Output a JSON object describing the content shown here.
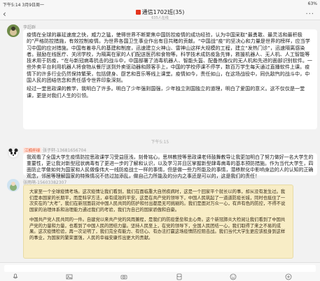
{
  "status_bar": {
    "time": "下午5:14",
    "date": "3月9日周一",
    "battery": "63%"
  },
  "header": {
    "title": "通信1702班(35)",
    "subtitle": "635人在线"
  },
  "messages": [
    {
      "sender_badge": "",
      "sender_name": "李超群",
      "paragraphs": [
        "疫情在全球的暴延速度之快，威力之猛，使得世界不断聚焦中国防控疫情的成功经验，认为中国采取“最勇敢、最灵活和最积极的”严格防控措施，有效控制疫情。为世界各国卫生事业作出有目共睹的贡献。“中国战“疫”的坚决心和力量是世界的榜样，应当学习中国的应对措施。中国有着非凡的基建和制度，迅速建立火神山、雷神山这样大规模的工程，建立“发热门诊”，迅速隔离感染者。鼓励在线医疗、关闭学校，为隔离在家的人们配送医药和食物等。科学技术成防疫急先锋，救援机器人、无人机、人工智能等技术用于防疫，“在与新冠病毒抗击的战斗中，中国部署了消毒机器人、智能头盔、配备热像仪的无人机和先进的面部识别软件。一些外卖平台利用机器人将食物从餐厅送到外卖驱动器和顾客手上，中国的学校停课不停学，数百万学生每天通过直播软件上课。疫情下的许多行业仍然保持繁荣，包括健身、厨艺和音乐等线上课堂。疫情如今，责任如山，在这场战役中，同仇敌忾的战斗中，中国人民的团结信念和责任感令世界印象深刻。",
        "经过一堂思政课的教学，我明白了许多。明白了少年强则国强，少年独立则国独立的道理，明白了爱国的意义。这不仅仅是一堂课，更是对我们人生的引领。"
      ]
    },
    {
      "timestamp": "下午5:15"
    },
    {
      "sender_badge": "江楠杯绿",
      "sender_name": "张子轩-13681656704",
      "paragraphs": [
        "我观看了全国大学生疫情防控思政课学习受益匪浅，刻骨铭心。思林教授等思政课老师鼓舞教导让我更加明白了努力做好一名大学生的重要性，更让我对新型冠状病毒有了更进一步的了解和认识，以及学习并且区掌握新型肆毒病毒的基本预防措施。作为当代大学生，四面防止学做如何为国家和人民做像伟大一线防疫战士一样的事情，但是做一些力所能及的事情，潜移默化中影响身边的人的认知的正确观念，邻居等理解国家的特殊情况不信过加添乱，做自己力所能及的分内之事还是可以的，这是我们的责任！"
      ]
    },
    {
      "sender_badge": "",
      "sender_name": "张雨萌-15603382307",
      "paragraphs": [
        "大家至一个全球疫情考场。这次疫情让我们看到，我们在面临重大自然疾病时，这是一个回家平个就长以的事，却从没有发生过。我们是本国家的长期平，而是科学方法，卓有成效的平安，这是在共产党的领导下，中国人民筑起了一道道防疫长城，同时也挺住了一次实在的“大考”，我们在新冠面前对中国人民共同的防护和付出都是无可挑剔的。我们是面对万众一心，有声有色的防控，不得不说国家的治理体系和治理能力通过我们的考验，我们为自己的国家骄傲和自豪。",
        "中国共产党人民共同的一件。自建党以来共产党的风雨兼程，是我们的防疫堡垒和主心骨。这个新冠肺炎大检阅让我们看到了中国共产党的力量和力量，也看到了中国人民的团结力量。坚持人民至上，在党的领导下，全国人民团结一心，我们取得了来之不易的成果。这次疫情检验，再一次证明了，我们完全有能力、有信心、有办法打赢这场疫情防控阻击战。我们当代大学生更应该投身到这样的事业，为国家的繁荣富强，人民的幸福安康作出更大的贡献。"
      ]
    }
  ],
  "toolbar": {
    "icons": [
      "voice-icon",
      "image-icon",
      "camera-icon",
      "red-packet-icon",
      "emoji-icon",
      "plus-icon"
    ]
  },
  "colors": {
    "accent": "#e4341d",
    "badge_bg": "#ffe3dc",
    "badge_fg": "#e2572e",
    "paper": "#f8edc6"
  }
}
